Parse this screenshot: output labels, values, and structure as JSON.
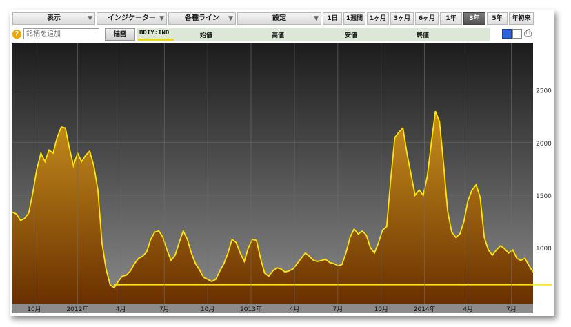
{
  "toolbar": {
    "menus": [
      {
        "label": "表示",
        "arrow": "▼"
      },
      {
        "label": "インジケーター",
        "arrow": "▼"
      },
      {
        "label": "各種ライン",
        "arrow": "▼"
      },
      {
        "label": "設定",
        "arrow": "▼"
      }
    ],
    "ranges": [
      "1日",
      "1週間",
      "1ヶ月",
      "3ヶ月",
      "6ヶ月",
      "1年",
      "3年",
      "5年",
      "年初来"
    ],
    "active_range": "3年"
  },
  "row2": {
    "help": "?",
    "add_placeholder": "銘柄を追加",
    "draw_label": "描画",
    "ticker": "BDIY:IND",
    "labels": [
      "始値",
      "高値",
      "安値",
      "終値"
    ]
  },
  "colors": {
    "line": "#ffe600",
    "fill_top": "#c8901e",
    "fill_bottom": "#6a3000",
    "bg_top": "#1c1c1c",
    "bg_bottom": "#8a8a8a"
  },
  "chart_data": {
    "type": "area",
    "title": "",
    "xlabel": "",
    "ylabel": "",
    "series": [
      {
        "values": [
          1340,
          1320,
          1260,
          1280,
          1330,
          1520,
          1750,
          1900,
          1820,
          1930,
          1900,
          2050,
          2150,
          2140,
          1950,
          1780,
          1900,
          1820,
          1880,
          1920,
          1780,
          1550,
          1050,
          800,
          650,
          620,
          680,
          730,
          740,
          780,
          850,
          900,
          920,
          960,
          1080,
          1150,
          1160,
          1100,
          980,
          880,
          930,
          1050,
          1160,
          1080,
          950,
          850,
          790,
          720,
          700,
          680,
          700,
          780,
          850,
          950,
          1080,
          1050,
          950,
          870,
          1000,
          1080,
          1070,
          900,
          760,
          730,
          780,
          810,
          800,
          770,
          780,
          800,
          850,
          900,
          950,
          920,
          880,
          870,
          880,
          890,
          860,
          850,
          830,
          840,
          950,
          1100,
          1180,
          1130,
          1160,
          1120,
          1000,
          950,
          1050,
          1170,
          1200,
          1650,
          2050,
          2100,
          2140,
          1900,
          1700,
          1500,
          1550,
          1500,
          1680,
          2000,
          2300,
          2200,
          1800,
          1350,
          1150,
          1100,
          1130,
          1250,
          1450,
          1550,
          1600,
          1480,
          1100,
          980,
          930,
          980,
          1020,
          990,
          950,
          980,
          900,
          880,
          900,
          830,
          770
        ]
      }
    ],
    "baseline": 650,
    "ylim": [
      470,
      2950
    ],
    "yticks": [
      1000,
      1500,
      2000,
      2500
    ],
    "xtick_labels": [
      "10月",
      "2012年",
      "4月",
      "7月",
      "10月",
      "2013年",
      "4月",
      "7月",
      "10月",
      "2014年",
      "4月",
      "7月"
    ],
    "grid": true
  }
}
